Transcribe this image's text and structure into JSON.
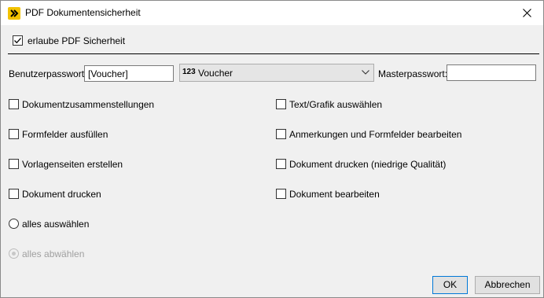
{
  "window": {
    "title": "PDF Dokumentensicherheit",
    "icon": "app-logo-icon",
    "close_icon": "close-icon"
  },
  "security": {
    "enable_label": "erlaube PDF Sicherheit",
    "enable_checked": true
  },
  "passwords": {
    "user_label": "Benutzerpasswort:",
    "user_value": "[Voucher]",
    "field_badge": "123",
    "field_value": "Voucher",
    "master_label": "Masterpasswort:",
    "master_value": ""
  },
  "permissions": {
    "left": [
      {
        "label": "Dokumentzusammenstellungen",
        "checked": false
      },
      {
        "label": "Formfelder ausfüllen",
        "checked": false
      },
      {
        "label": "Vorlagenseiten erstellen",
        "checked": false
      },
      {
        "label": "Dokument drucken",
        "checked": false
      }
    ],
    "right": [
      {
        "label": "Text/Grafik auswählen",
        "checked": false
      },
      {
        "label": "Anmerkungen und Formfelder bearbeiten",
        "checked": false
      },
      {
        "label": "Dokument drucken (niedrige Qualität)",
        "checked": false
      },
      {
        "label": "Dokument bearbeiten",
        "checked": false
      }
    ]
  },
  "selection": {
    "select_all": "alles auswählen",
    "deselect_all": "alles abwählen"
  },
  "buttons": {
    "ok": "OK",
    "cancel": "Abbrechen"
  },
  "colors": {
    "title_bg": "#ffffff",
    "dialog_bg": "#f0f0f0",
    "icon_yellow": "#f2c200",
    "default_button_border": "#0078d7"
  }
}
